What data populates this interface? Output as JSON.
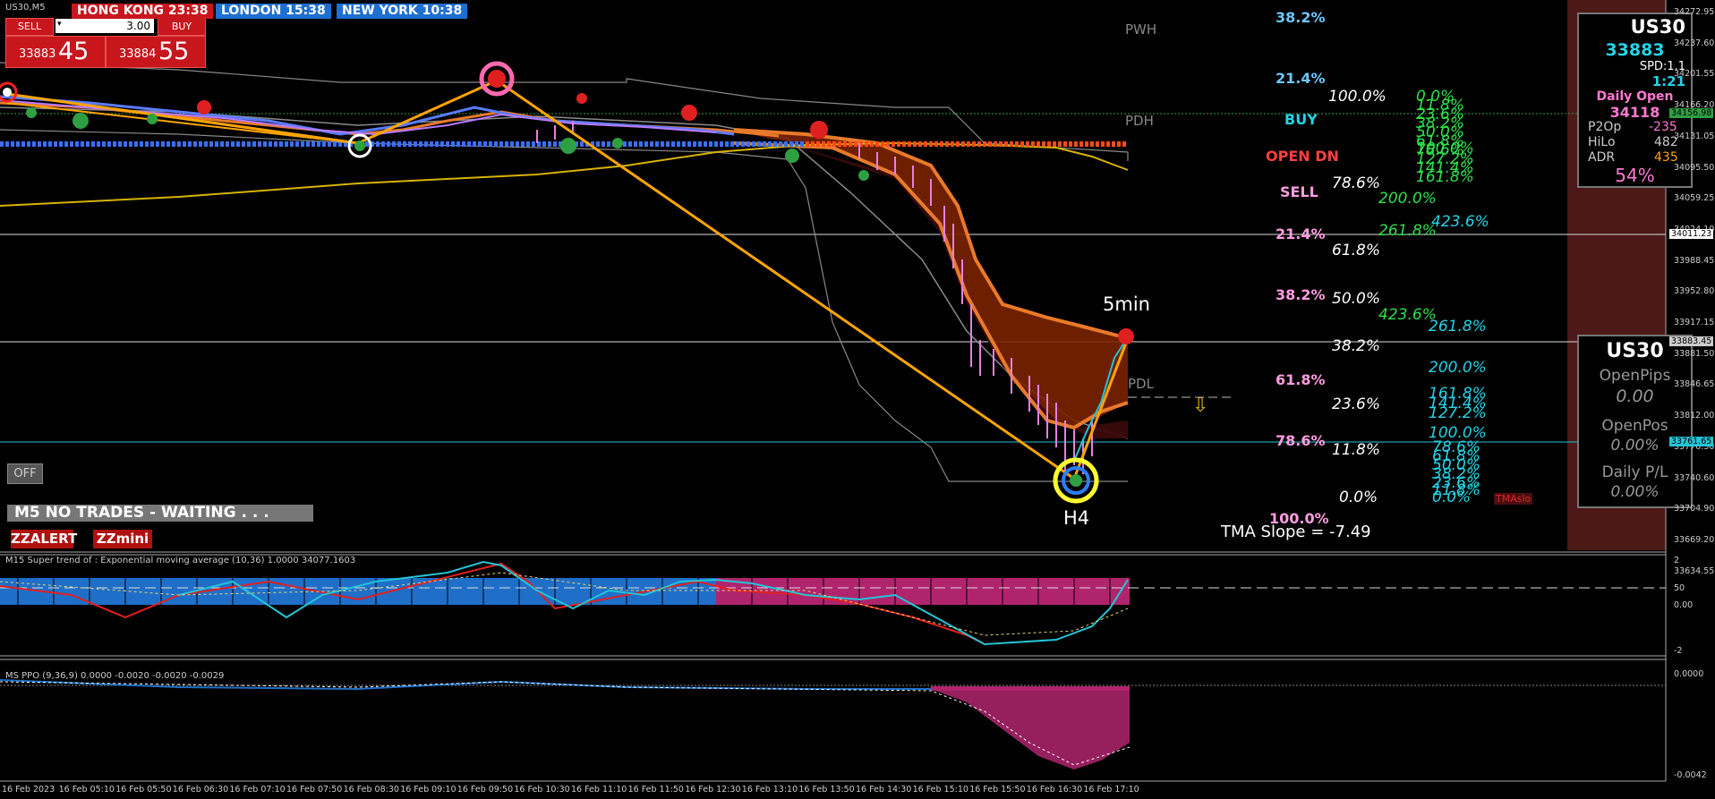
{
  "symbol": "US30,M5",
  "trade_panel": {
    "sell_label": "SELL",
    "buy_label": "BUY",
    "lot": "3.00",
    "sell_price_small": "33883",
    "sell_price_big": "45",
    "buy_price_small": "33884",
    "buy_price_big": "55"
  },
  "clocks": {
    "hong_kong": "HONG KONG  23:38",
    "london": "LONDON  15:38",
    "new_york": "NEW YORK  10:38"
  },
  "off_button": "OFF",
  "status": "M5  NO TRADES - WAITING . . .",
  "buttons": {
    "zzalert": "ZZALERT",
    "zzmini": "ZZmini"
  },
  "chart_labels": {
    "pwh": "PWH",
    "pdh": "PDH",
    "pdl": "PDL",
    "five_min": "5min",
    "h4": "H4",
    "tma_slope": "TMA Slope = -7.49",
    "tma_tag": "TMAslo"
  },
  "signals": {
    "buy": "BUY",
    "open_dn": "OPEN DN",
    "sell": "SELL"
  },
  "fib_col_a": [
    {
      "text": "38.2%",
      "color": "#6ec6ff"
    },
    {
      "text": "21.4%",
      "color": "#6ec6ff"
    },
    {
      "text": "21.4%",
      "color": "#ff9de0"
    },
    {
      "text": "38.2%",
      "color": "#ff9de0"
    },
    {
      "text": "61.8%",
      "color": "#ff9de0"
    },
    {
      "text": "78.6%",
      "color": "#ff9de0"
    },
    {
      "text": "100.0%",
      "color": "#ff9de0"
    }
  ],
  "fib_col_b": [
    "100.0%",
    "78.6%",
    "61.8%",
    "50.0%",
    "38.2%",
    "23.6%",
    "11.8%",
    "0.0%"
  ],
  "fib_col_c_green": [
    "0.0%",
    "11.8%",
    "23.6%",
    "38.2%",
    "50.0%",
    "61.8%",
    "78.6%",
    "100.0%",
    "127.2%",
    "141.4%",
    "161.8%",
    "200.0%",
    "261.8%",
    "423.6%"
  ],
  "fib_col_d_cyan": [
    "423.6%",
    "261.8%",
    "200.0%",
    "161.8%",
    "141.4%",
    "127.2%",
    "100.0%",
    "78.6%",
    "61.8%",
    "50.0%",
    "38.2%",
    "23.6%",
    "11.8%",
    "0.0%"
  ],
  "info_panel": {
    "title": "US30",
    "price": "33883",
    "spread": "SPD:1.1",
    "time": "1:21",
    "daily_open_label": "Daily Open",
    "daily_open": "34118",
    "p2op_label": "P2Op",
    "p2op": "-235",
    "hilo_label": "HiLo",
    "hilo": "482",
    "adr_label": "ADR",
    "adr": "435",
    "pct": "54%"
  },
  "pl_panel": {
    "title": "US30",
    "open_pips_label": "OpenPips",
    "open_pips": "0.00",
    "open_pos_label": "OpenPos",
    "open_pos": "0.00%",
    "daily_pl_label": "Daily P/L",
    "daily_pl": "0.00%"
  },
  "price_axis": {
    "ticks": [
      "34272.95",
      "34237.60",
      "34201.55",
      "34166.20",
      "34131.05",
      "34095.50",
      "34059.25",
      "34024.10",
      "33988.45",
      "33952.80",
      "33917.15",
      "33881.50",
      "33846.65",
      "33812.00",
      "33776.30",
      "33740.60",
      "33704.90",
      "33669.20",
      "33634.55"
    ],
    "tags": [
      {
        "text": "34156.98",
        "color": "#2ea043"
      },
      {
        "text": "34011.23",
        "color": "#ffffff"
      },
      {
        "text": "33883.45",
        "color": "#cccccc"
      },
      {
        "text": "33761.65",
        "color": "#23c4d6"
      }
    ]
  },
  "indicator1": {
    "label": "M15  Super trend of : Exponential moving average (10,36)  1.0000 34077.1603",
    "ticks": [
      "2",
      "50",
      "0.00",
      "-2"
    ]
  },
  "indicator2": {
    "label": "MS PPO (9,36,9) 0.0000 -0.0020 -0.0020 -0.0029",
    "ticks": [
      "0.0000",
      "-0.0042"
    ]
  },
  "time_axis": [
    "16 Feb 2023",
    "16 Feb 05:10",
    "16 Feb 05:50",
    "16 Feb 06:30",
    "16 Feb 07:10",
    "16 Feb 07:50",
    "16 Feb 08:30",
    "16 Feb 09:10",
    "16 Feb 09:50",
    "16 Feb 10:30",
    "16 Feb 11:10",
    "16 Feb 11:50",
    "16 Feb 12:30",
    "16 Feb 13:10",
    "16 Feb 13:50",
    "16 Feb 14:30",
    "16 Feb 15:10",
    "16 Feb 15:50",
    "16 Feb 16:30",
    "16 Feb 17:10"
  ],
  "colors": {
    "sell_red": "#c8161d",
    "clock_hk": "#c8161d",
    "clock_london": "#1e6fd0",
    "clock_ny": "#1e6fd0",
    "zigzag": "#ffa500",
    "ma_yellow": "#d6b400",
    "tma_band": "#8a2a00",
    "candle_pink": "#e77fe0",
    "panel_maroon": "#4d1818"
  }
}
